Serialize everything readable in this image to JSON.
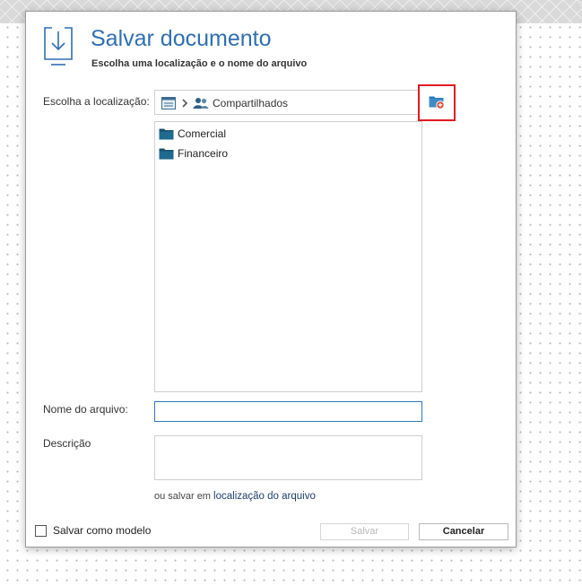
{
  "dialog": {
    "title": "Salvar documento",
    "subtitle": "Escolha uma localização e o nome do arquivo",
    "title_icon": "download-tray-icon"
  },
  "location": {
    "label": "Escolha a localização:",
    "breadcrumb": {
      "root_icon": "computer-icon",
      "separator_icon": "chevron-right-icon",
      "current_icon": "shared-users-icon",
      "current": "Compartilhados"
    },
    "new_folder_icon": "new-folder-icon",
    "folders": [
      {
        "label": "Comercial",
        "icon": "folder-icon"
      },
      {
        "label": "Financeiro",
        "icon": "folder-icon"
      }
    ]
  },
  "filename": {
    "label": "Nome do arquivo:",
    "value": ""
  },
  "description": {
    "label": "Descrição",
    "value": ""
  },
  "alt_save": {
    "prefix": "ou salvar em",
    "link": "localização do arquivo"
  },
  "template": {
    "label": "Salvar como modelo",
    "checked": false
  },
  "buttons": {
    "save": "Salvar",
    "save_enabled": false,
    "cancel": "Cancelar"
  },
  "colors": {
    "accent": "#2f6fb1",
    "folder": "#1f5a7a",
    "highlight_border": "#e11b22"
  }
}
